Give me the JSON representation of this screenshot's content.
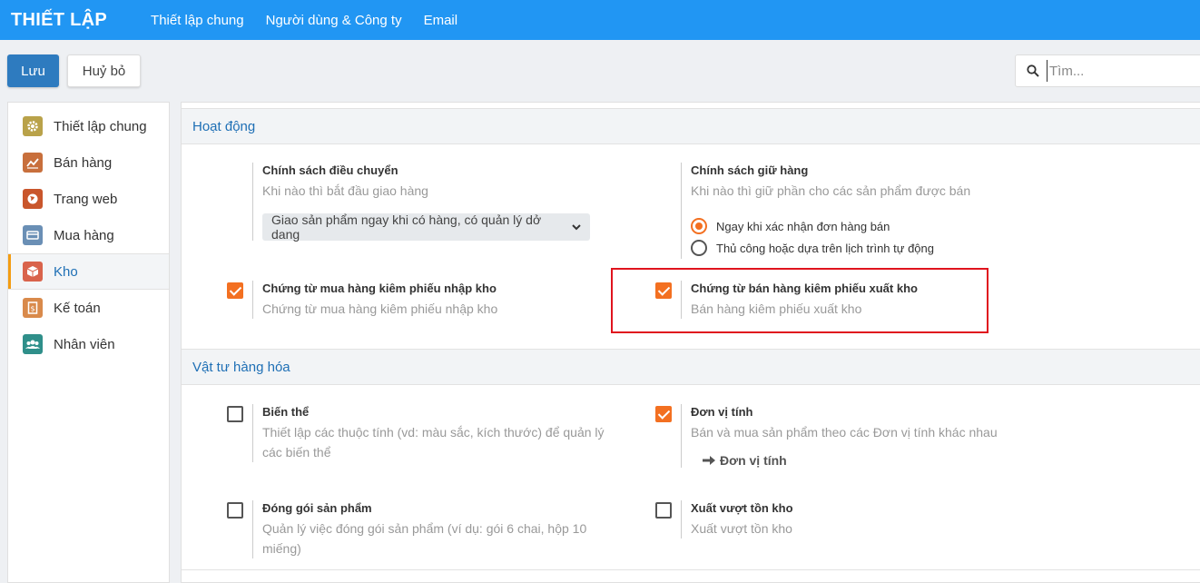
{
  "topbar": {
    "title": "THIẾT LẬP",
    "nav": [
      "Thiết lập chung",
      "Người dùng & Công ty",
      "Email"
    ]
  },
  "actions": {
    "save": "Lưu",
    "cancel": "Huỷ bỏ",
    "search_placeholder": "Tìm..."
  },
  "sidebar": {
    "items": [
      {
        "label": "Thiết lập chung",
        "icon": "gear-icon",
        "color": "#b9a24a"
      },
      {
        "label": "Bán hàng",
        "icon": "chart-icon",
        "color": "#c86f3c"
      },
      {
        "label": "Trang web",
        "icon": "globe-icon",
        "color": "#c9562c"
      },
      {
        "label": "Mua hàng",
        "icon": "card-icon",
        "color": "#6a8fb5"
      },
      {
        "label": "Kho",
        "icon": "box-icon",
        "color": "#d9634b",
        "active": true
      },
      {
        "label": "Kế toán",
        "icon": "invoice-icon",
        "color": "#d98a4b"
      },
      {
        "label": "Nhân viên",
        "icon": "users-icon",
        "color": "#2f8f8a"
      }
    ]
  },
  "sections": {
    "operations": {
      "title": "Hoạt động",
      "transfer_policy": {
        "title": "Chính sách điều chuyển",
        "desc": "Khi nào thì bắt đầu giao hàng",
        "selected": "Giao sản phẩm ngay khi có hàng, có quản lý dở dang"
      },
      "reservation_policy": {
        "title": "Chính sách giữ hàng",
        "desc": "Khi nào thì giữ phần cho các sản phẩm được bán",
        "options": [
          "Ngay khi xác nhận đơn hàng bán",
          "Thủ công hoặc dựa trên lịch trình tự động"
        ],
        "selected_index": 0
      },
      "purchase_receipt": {
        "title": "Chứng từ mua hàng kiêm phiếu nhập kho",
        "desc": "Chứng từ mua hàng kiêm phiếu nhập kho",
        "checked": true
      },
      "sale_delivery": {
        "title": "Chứng từ bán hàng kiêm phiếu xuất kho",
        "desc": "Bán hàng kiêm phiếu xuất kho",
        "checked": true
      }
    },
    "products": {
      "title": "Vật tư hàng hóa",
      "variants": {
        "title": "Biến thể",
        "desc": "Thiết lập các thuộc tính (vd: màu sắc, kích thước) để quản lý các biến thể",
        "checked": false
      },
      "uom": {
        "title": "Đơn vị tính",
        "desc": "Bán và mua sản phẩm theo các Đơn vị tính khác nhau",
        "link": "Đơn vị tính",
        "checked": true
      },
      "packaging": {
        "title": "Đóng gói sản phẩm",
        "desc": "Quản lý việc đóng gói sản phẩm (ví dụ: gói 6 chai, hộp 10 miếng)",
        "checked": false
      },
      "negative_stock": {
        "title": "Xuất vượt tồn kho",
        "desc": "Xuất vượt tồn kho",
        "checked": false
      }
    }
  },
  "colors": {
    "topbar": "#2196f3",
    "primary": "#2e7bbf",
    "accent": "#f37021",
    "highlight": "#e0141e"
  }
}
